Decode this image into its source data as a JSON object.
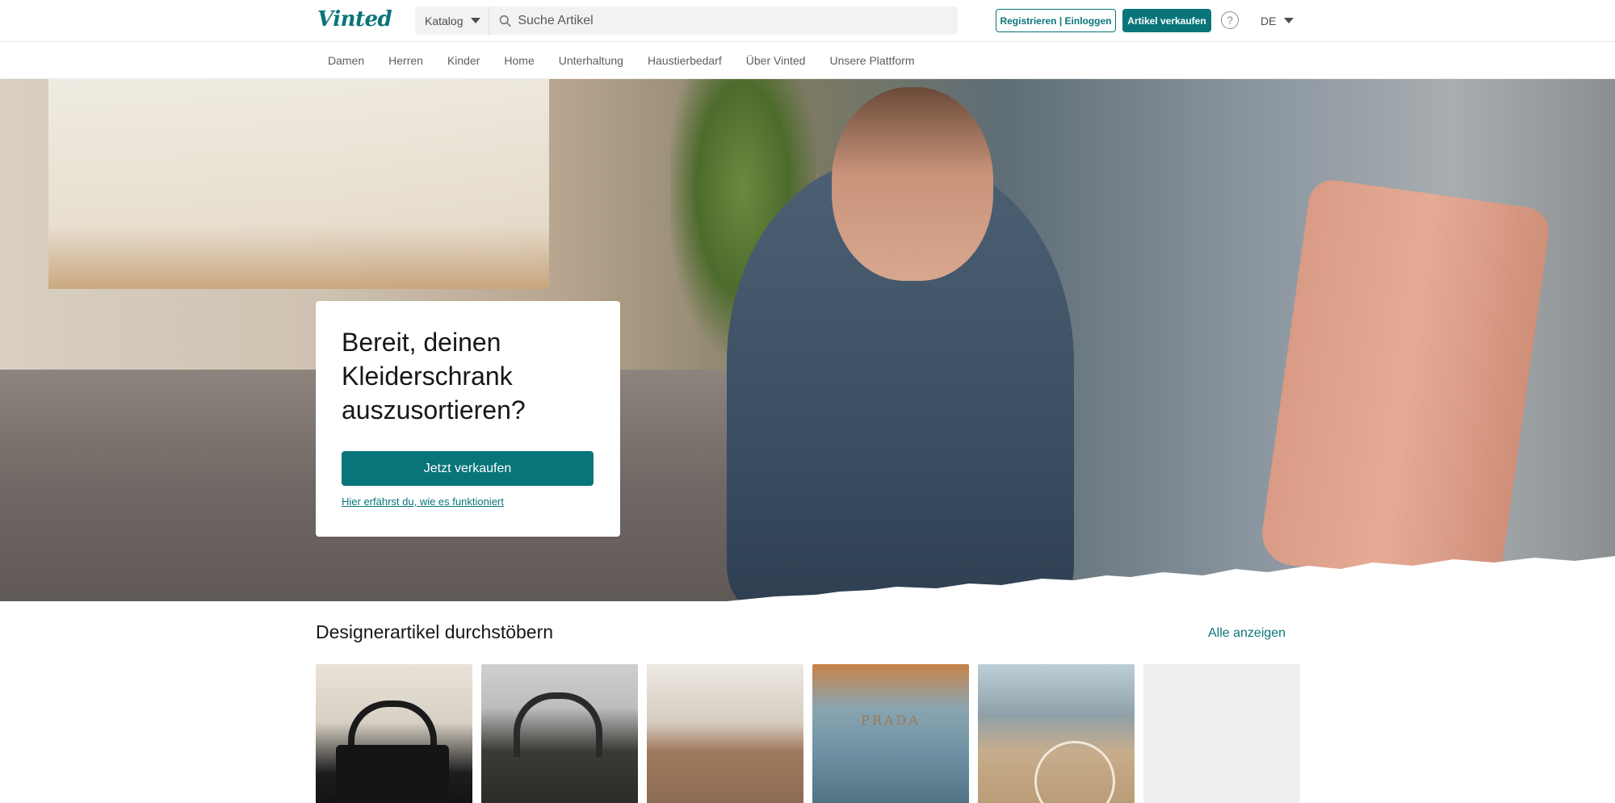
{
  "header": {
    "logo": "Vinted",
    "catalog_label": "Katalog",
    "search_placeholder": "Suche Artikel",
    "register_label": "Registrieren | Einloggen",
    "sell_label": "Artikel verkaufen",
    "help_symbol": "?",
    "language": "DE"
  },
  "nav": {
    "items": [
      "Damen",
      "Herren",
      "Kinder",
      "Home",
      "Unterhaltung",
      "Haustierbedarf",
      "Über Vinted",
      "Unsere Plattform"
    ]
  },
  "hero": {
    "title": "Bereit, deinen Kleiderschrank auszusortieren?",
    "button": "Jetzt verkaufen",
    "link": "Hier erfährst du, wie es funktioniert"
  },
  "designer": {
    "title": "Designerartikel durchstöbern",
    "see_all": "Alle anzeigen",
    "brand_text_1": "PRADA"
  },
  "colors": {
    "accent": "#09757a"
  }
}
